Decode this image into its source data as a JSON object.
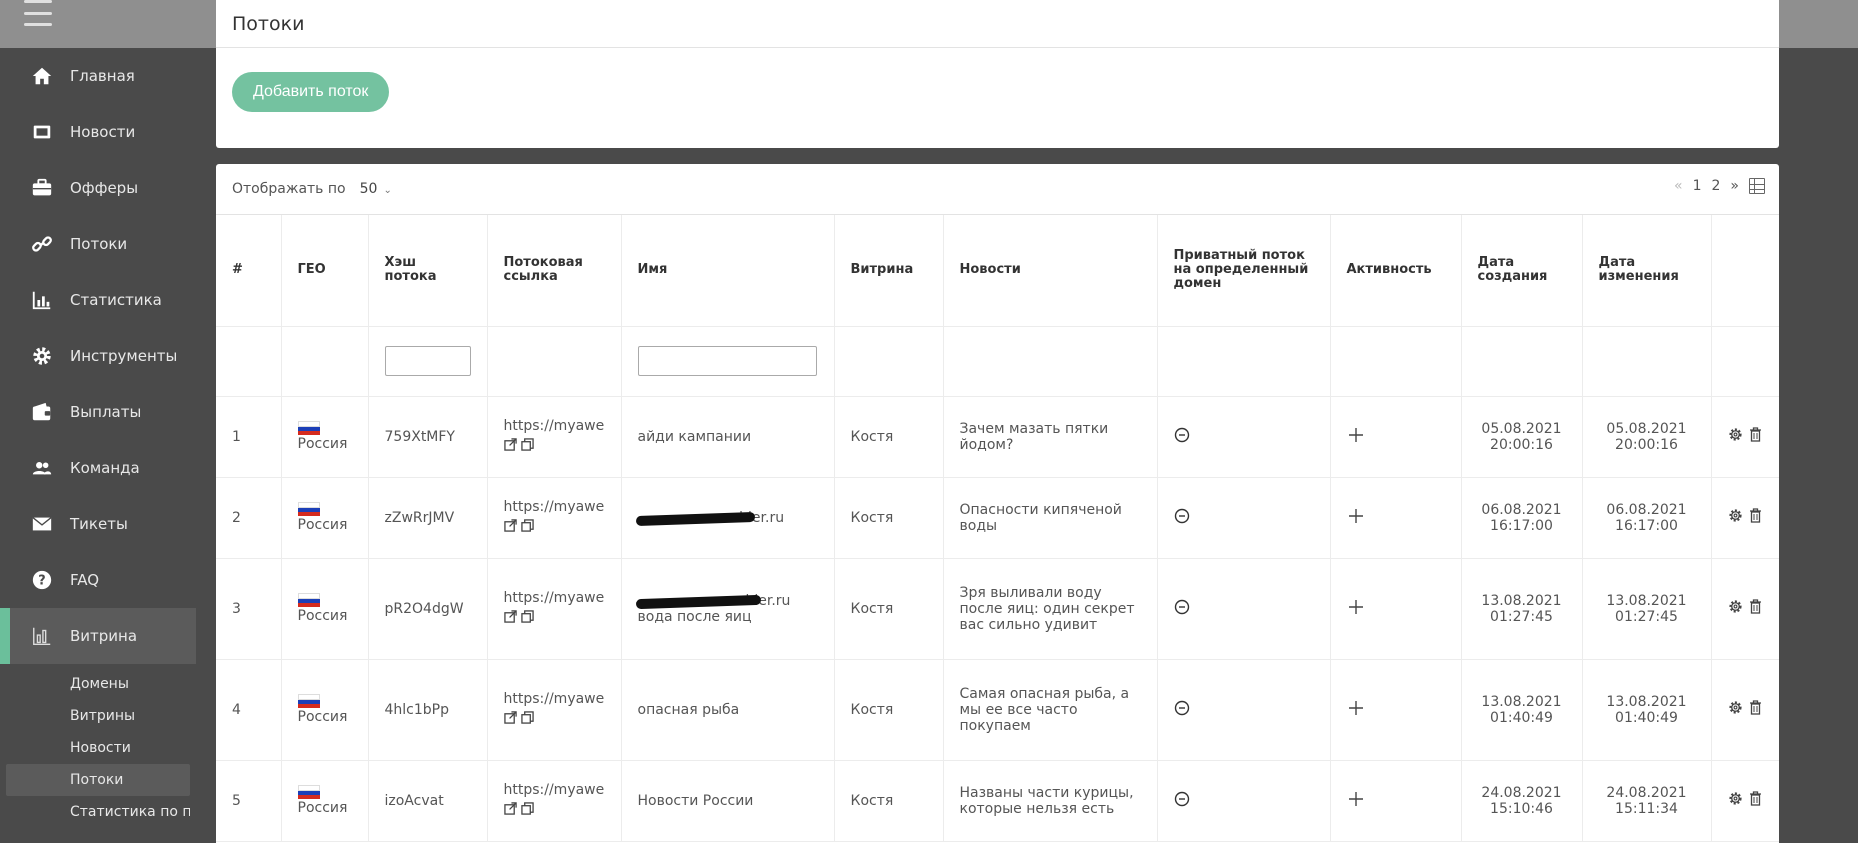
{
  "sidebar": {
    "items": [
      {
        "label": "Главная",
        "icon": "home-icon"
      },
      {
        "label": "Новости",
        "icon": "newspaper-icon"
      },
      {
        "label": "Офферы",
        "icon": "briefcase-icon"
      },
      {
        "label": "Потоки",
        "icon": "link-icon"
      },
      {
        "label": "Статистика",
        "icon": "bar-chart-icon"
      },
      {
        "label": "Инструменты",
        "icon": "gear-icon"
      },
      {
        "label": "Выплаты",
        "icon": "wallet-icon"
      },
      {
        "label": "Команда",
        "icon": "users-icon"
      },
      {
        "label": "Тикеты",
        "icon": "envelope-icon"
      },
      {
        "label": "FAQ",
        "icon": "question-icon"
      },
      {
        "label": "Витрина",
        "icon": "storefront-chart-icon"
      }
    ],
    "subitems": [
      "Домены",
      "Витрины",
      "Новости",
      "Потоки",
      "Статистика по п..."
    ]
  },
  "page": {
    "title": "Потоки",
    "add_button": "Добавить поток"
  },
  "toolbar": {
    "perpage_label": "Отображать по",
    "perpage_value": "50",
    "pager_prev": "«",
    "pager_pages": [
      "1",
      "2"
    ],
    "pager_next": "»"
  },
  "table": {
    "headers": [
      "#",
      "ГЕО",
      "Хэш потока",
      "Потоковая ссылка",
      "Имя",
      "Витрина",
      "Новости",
      "Приватный поток на определенный домен",
      "Активность",
      "Дата создания",
      "Дата изменения",
      ""
    ],
    "rows": [
      {
        "num": "1",
        "geo": "Россия",
        "hash": "759XtMFY",
        "link": "https://myawes",
        "name": "айди кампании",
        "vitrina": "Костя",
        "news": "Зачем мазать пятки йодом?",
        "created": "05.08.2021 20:00:16",
        "modified": "05.08.2021 20:00:16"
      },
      {
        "num": "2",
        "geo": "Россия",
        "hash": "zZwRrJMV",
        "link": "https://myawes",
        "name": "mbler.ru",
        "vitrina": "Костя",
        "news": "Опасности кипяченой воды",
        "created": "06.08.2021 16:17:00",
        "modified": "06.08.2021 16:17:00"
      },
      {
        "num": "3",
        "geo": "Россия",
        "hash": "pR2O4dgW",
        "link": "https://myawes",
        "name": "rambler.ru",
        "name2": "вода после яиц",
        "vitrina": "Костя",
        "news": "Зря выливали воду после яиц: один секрет вас сильно удивит",
        "created": "13.08.2021 01:27:45",
        "modified": "13.08.2021 01:27:45"
      },
      {
        "num": "4",
        "geo": "Россия",
        "hash": "4hlc1bPp",
        "link": "https://myawes",
        "name": "опасная рыба",
        "vitrina": "Костя",
        "news": "Самая опасная рыба, а мы ее все часто покупаем",
        "created": "13.08.2021 01:40:49",
        "modified": "13.08.2021 01:40:49"
      },
      {
        "num": "5",
        "geo": "Россия",
        "hash": "izoAcvat",
        "link": "https://myawes",
        "name": "Новости России",
        "vitrina": "Костя",
        "news": "Названы части курицы, которые нельзя есть",
        "created": "24.08.2021 15:10:46",
        "modified": "24.08.2021 15:11:34"
      }
    ]
  },
  "colors": {
    "accent": "#74c2a0",
    "sidebar_bg": "#4a4a4a",
    "topbar_bg": "#8f8f8f"
  }
}
